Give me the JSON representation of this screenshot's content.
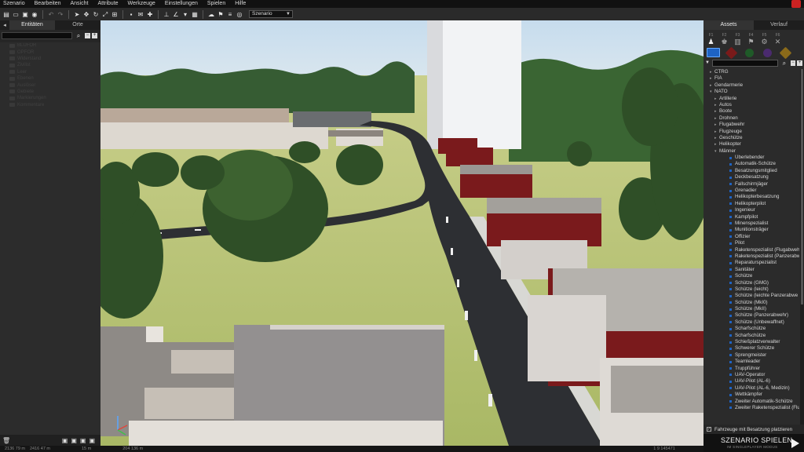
{
  "menu": [
    "Szenario",
    "Bearbeiten",
    "Ansicht",
    "Attribute",
    "Werkzeuge",
    "Einstellungen",
    "Spielen",
    "Hilfe"
  ],
  "toolbar": {
    "scenario_select": "Szenario"
  },
  "left_panel": {
    "tabs": [
      "Entitäten",
      "Orte"
    ],
    "tree": [
      "BLUFOR",
      "OPFOR",
      "Widerstand",
      "Zivilist",
      "Leer",
      "Ebenen",
      "Auslöser",
      "Gebiete",
      "Markierungen",
      "Kommentare"
    ]
  },
  "right_panel": {
    "tabs": [
      "Assets",
      "Verlauf"
    ],
    "icon_keys": [
      "F1",
      "F2",
      "F3",
      "F4",
      "F5",
      "F6"
    ],
    "tree": [
      {
        "label": "CTRG",
        "level": 0,
        "toggle": "▸"
      },
      {
        "label": "FIA",
        "level": 0,
        "toggle": "▸"
      },
      {
        "label": "Gendarmerie",
        "level": 0,
        "toggle": "▸"
      },
      {
        "label": "NATO",
        "level": 0,
        "toggle": "▾"
      },
      {
        "label": "Artillerie",
        "level": 1,
        "toggle": "▸"
      },
      {
        "label": "Autos",
        "level": 1,
        "toggle": "▸"
      },
      {
        "label": "Boote",
        "level": 1,
        "toggle": "▸"
      },
      {
        "label": "Drohnen",
        "level": 1,
        "toggle": "▸"
      },
      {
        "label": "Flugabwehr",
        "level": 1,
        "toggle": "▸"
      },
      {
        "label": "Flugzeuge",
        "level": 1,
        "toggle": "▸"
      },
      {
        "label": "Geschütze",
        "level": 1,
        "toggle": "▸"
      },
      {
        "label": "Helikopter",
        "level": 1,
        "toggle": "▸"
      },
      {
        "label": "Männer",
        "level": 1,
        "toggle": "▾"
      },
      {
        "label": "Überlebender",
        "level": 2
      },
      {
        "label": "Automatik-Schütze",
        "level": 2
      },
      {
        "label": "Besatzungsmitglied",
        "level": 2
      },
      {
        "label": "Deckbesatzung",
        "level": 2
      },
      {
        "label": "Fallschirmjäger",
        "level": 2
      },
      {
        "label": "Grenadier",
        "level": 2
      },
      {
        "label": "Helikopterbesatzung",
        "level": 2
      },
      {
        "label": "Helikopterpilot",
        "level": 2
      },
      {
        "label": "Ingenieur",
        "level": 2
      },
      {
        "label": "Kampfpilot",
        "level": 2
      },
      {
        "label": "Minenspezialist",
        "level": 2
      },
      {
        "label": "Munitionsträger",
        "level": 2
      },
      {
        "label": "Offizier",
        "level": 2
      },
      {
        "label": "Pilot",
        "level": 2
      },
      {
        "label": "Raketenspezialist (Flugabwehr)",
        "level": 2
      },
      {
        "label": "Raketenspezialist (Panzerabwehr)",
        "level": 2
      },
      {
        "label": "Reparaturspezialist",
        "level": 2
      },
      {
        "label": "Sanitäter",
        "level": 2
      },
      {
        "label": "Schütze",
        "level": 2
      },
      {
        "label": "Schütze (GMG)",
        "level": 2
      },
      {
        "label": "Schütze (leicht)",
        "level": 2
      },
      {
        "label": "Schütze (leichte Panzerabwe",
        "level": 2
      },
      {
        "label": "Schütze (MkI0)",
        "level": 2
      },
      {
        "label": "Schütze (MkII)",
        "level": 2
      },
      {
        "label": "Schütze (Panzerabwehr)",
        "level": 2
      },
      {
        "label": "Schütze (Unbewaffnet)",
        "level": 2
      },
      {
        "label": "Scharfschütze",
        "level": 2
      },
      {
        "label": "Scharfschütze",
        "level": 2
      },
      {
        "label": "Schießplatzverwalter",
        "level": 2
      },
      {
        "label": "Schwerer Schütze",
        "level": 2
      },
      {
        "label": "Sprengmeister",
        "level": 2
      },
      {
        "label": "Teamleader",
        "level": 2
      },
      {
        "label": "Truppführer",
        "level": 2
      },
      {
        "label": "UAV-Operator",
        "level": 2
      },
      {
        "label": "UAV-Pilot (AL-6)",
        "level": 2
      },
      {
        "label": "UAV-Pilot (AL-6, Medizin)",
        "level": 2
      },
      {
        "label": "Wettkämpfer",
        "level": 2
      },
      {
        "label": "Zweiter Automatik-Schütze",
        "level": 2
      },
      {
        "label": "Zweiter Raketenspezialist (Flugab",
        "level": 2
      }
    ],
    "vehicle_checkbox_label": "Fahrzeuge mit Besatzung platzieren",
    "vehicle_checkbox_checked": true
  },
  "play": {
    "title": "SZENARIO SPIELEN",
    "subtitle": "IM SINGLEPLAYER MODUS"
  },
  "statusbar": [
    "2136 79 m",
    "2416 47 m",
    "15 m",
    "204 136 m",
    "1 9 145471"
  ],
  "colors": {
    "sky": "#cfe0ee",
    "grass": "#b9c27a",
    "road": "#2d2f33",
    "roof": "#8e8a86",
    "brick_red": "#7a1a1c",
    "blufor": "#1e63c4"
  }
}
